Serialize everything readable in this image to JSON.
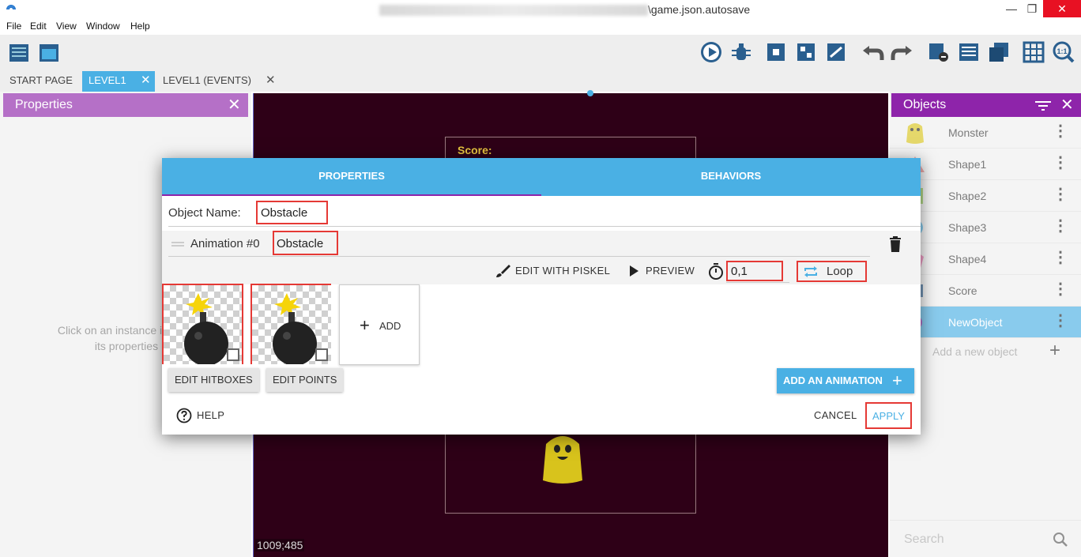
{
  "window": {
    "title_suffix": "\\game.json.autosave",
    "minimize": "—",
    "restore": "❐",
    "close": "✕"
  },
  "menu": [
    "File",
    "Edit",
    "View",
    "Window",
    "Help"
  ],
  "tabs": [
    {
      "label": "START PAGE"
    },
    {
      "label": "LEVEL1"
    },
    {
      "label": "LEVEL1 (EVENTS)"
    }
  ],
  "tab_close": "✕",
  "left_panel": {
    "title": "Properties",
    "message_line1": "Click on an instance in the s",
    "message_line2": "its properties"
  },
  "scene": {
    "score_text": "Score:",
    "coords": "1009;485"
  },
  "objects_panel": {
    "title": "Objects",
    "items": [
      {
        "name": "Monster"
      },
      {
        "name": "Shape1"
      },
      {
        "name": "Shape2"
      },
      {
        "name": "Shape3"
      },
      {
        "name": "Shape4"
      },
      {
        "name": "Score"
      },
      {
        "name": "NewObject"
      }
    ],
    "add_label": "Add a new object",
    "search_placeholder": "Search"
  },
  "dialog": {
    "tabs": [
      "PROPERTIES",
      "BEHAVIORS"
    ],
    "object_name_label": "Object Name:",
    "object_name_value": "Obstacle",
    "animation_label": "Animation #0",
    "animation_name_value": "Obstacle",
    "edit_with_piskel": "EDIT WITH PISKEL",
    "preview": "PREVIEW",
    "timer_value": "0,1",
    "loop": "Loop",
    "add": "ADD",
    "edit_hitboxes": "EDIT HITBOXES",
    "edit_points": "EDIT POINTS",
    "add_animation": "ADD AN ANIMATION",
    "help": "HELP",
    "cancel": "CANCEL",
    "apply": "APPLY"
  },
  "colors": {
    "accent": "#4ab0e4",
    "purple": "#8e24aa",
    "highlight_red": "#e53935",
    "scene_bg": "#2e0017"
  }
}
